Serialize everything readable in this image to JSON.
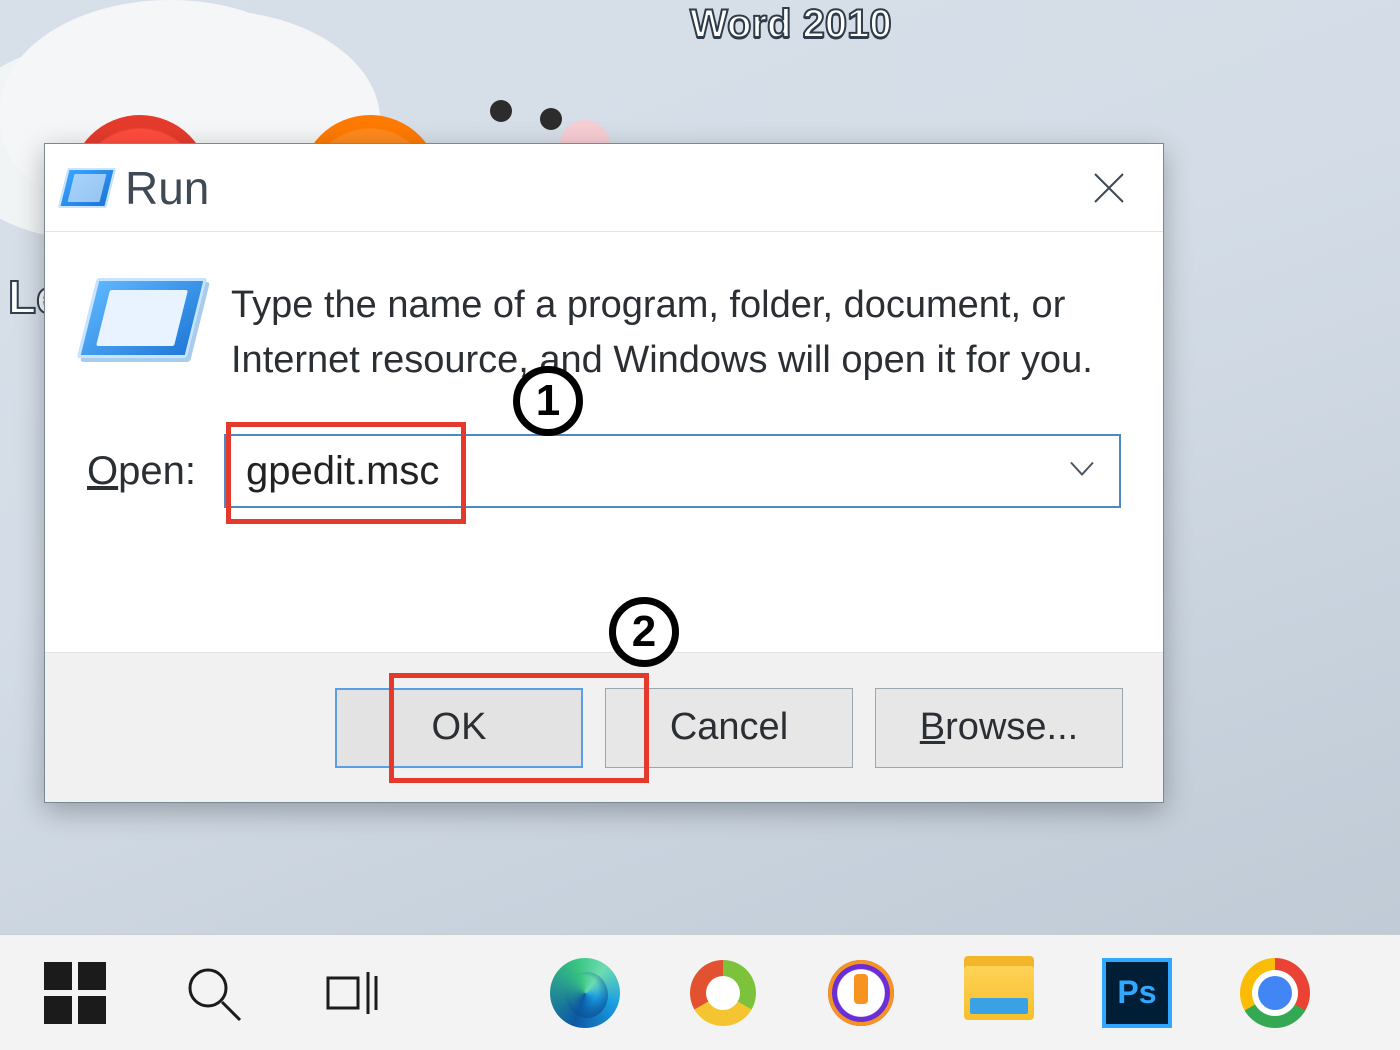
{
  "desktop": {
    "word_label": "Word 2010",
    "left_fragment": "Le"
  },
  "dialog": {
    "title": "Run",
    "description": "Type the name of a program, folder, document, or Internet resource, and Windows will open it for you.",
    "open_label_prefix": "O",
    "open_label_rest": "pen:",
    "input_value": "gpedit.msc",
    "buttons": {
      "ok": "OK",
      "cancel": "Cancel",
      "browse_prefix": "B",
      "browse_rest": "rowse..."
    }
  },
  "annotations": {
    "step1": "1",
    "step2": "2"
  },
  "taskbar": {
    "ps_label": "Ps"
  }
}
